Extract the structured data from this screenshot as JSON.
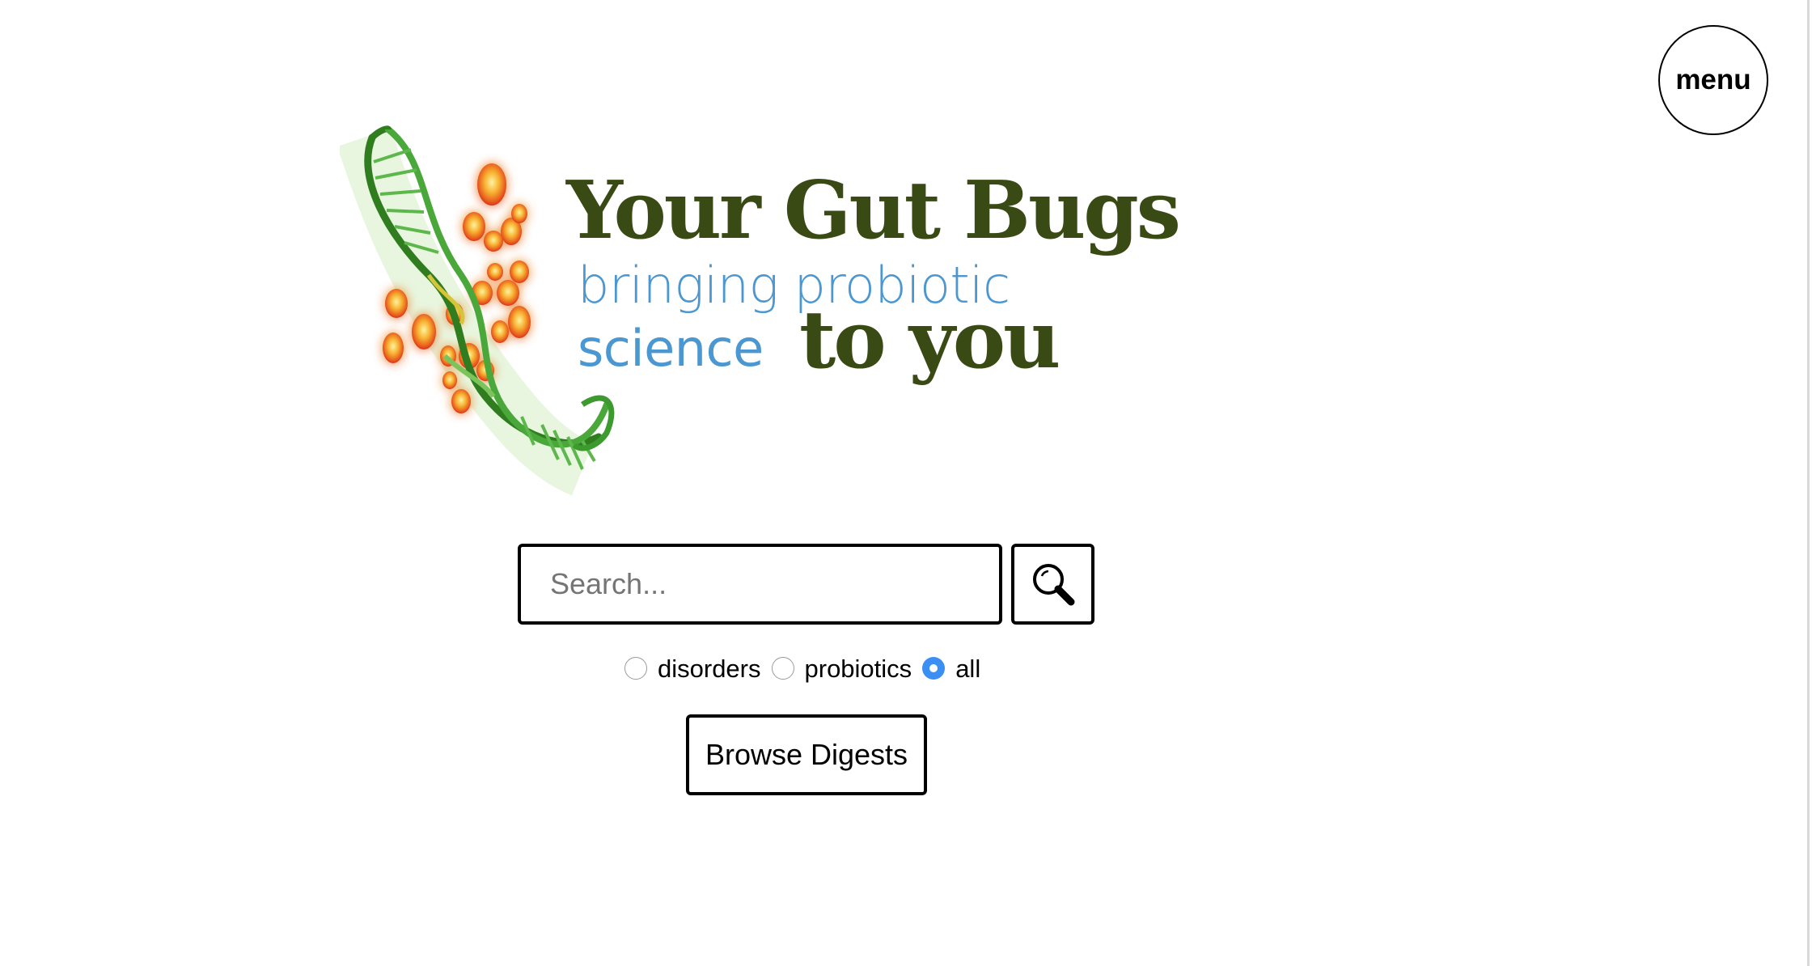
{
  "header": {
    "menu_label": "menu"
  },
  "logo": {
    "title": "Your Gut Bugs",
    "tagline_line1": "bringing probiotic",
    "tagline_line2": "science",
    "tagline_emphasis": "to you",
    "colors": {
      "title": "#3a4a14",
      "tagline": "#4a97d1",
      "dna": "#3d9a2e",
      "bacteria": "#f0a020"
    },
    "icon": "dna-bacteria-illustration"
  },
  "search": {
    "placeholder": "Search...",
    "value": "",
    "button_icon": "search-icon"
  },
  "filters": {
    "options": [
      {
        "label": "disorders",
        "checked": false
      },
      {
        "label": "probiotics",
        "checked": false
      },
      {
        "label": "all",
        "checked": true
      }
    ],
    "accent_color": "#3b8ef3"
  },
  "browse": {
    "label": "Browse Digests"
  }
}
